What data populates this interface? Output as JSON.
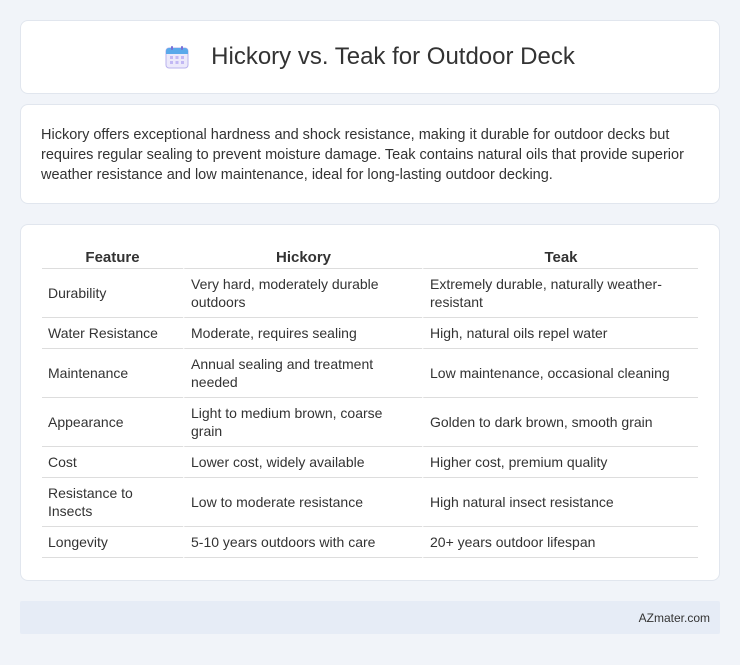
{
  "header": {
    "title": "Hickory vs. Teak for Outdoor Deck",
    "icon": "calendar-icon"
  },
  "summary": {
    "text": "Hickory offers exceptional hardness and shock resistance, making it durable for outdoor decks but requires regular sealing to prevent moisture damage. Teak contains natural oils that provide superior weather resistance and low maintenance, ideal for long-lasting outdoor decking."
  },
  "table": {
    "headers": [
      "Feature",
      "Hickory",
      "Teak"
    ],
    "rows": [
      [
        "Durability",
        "Very hard, moderately durable outdoors",
        "Extremely durable, naturally weather-resistant"
      ],
      [
        "Water Resistance",
        "Moderate, requires sealing",
        "High, natural oils repel water"
      ],
      [
        "Maintenance",
        "Annual sealing and treatment needed",
        "Low maintenance, occasional cleaning"
      ],
      [
        "Appearance",
        "Light to medium brown, coarse grain",
        "Golden to dark brown, smooth grain"
      ],
      [
        "Cost",
        "Lower cost, widely available",
        "Higher cost, premium quality"
      ],
      [
        "Resistance to Insects",
        "Low to moderate resistance",
        "High natural insect resistance"
      ],
      [
        "Longevity",
        "5-10 years outdoors with care",
        "20+ years outdoor lifespan"
      ]
    ]
  },
  "footer": {
    "brand": "AZmater.com"
  },
  "colors": {
    "background": "#f1f4f9",
    "card": "#ffffff",
    "footer": "#e6ecf6",
    "icon_accent": "#8a7fe0"
  }
}
